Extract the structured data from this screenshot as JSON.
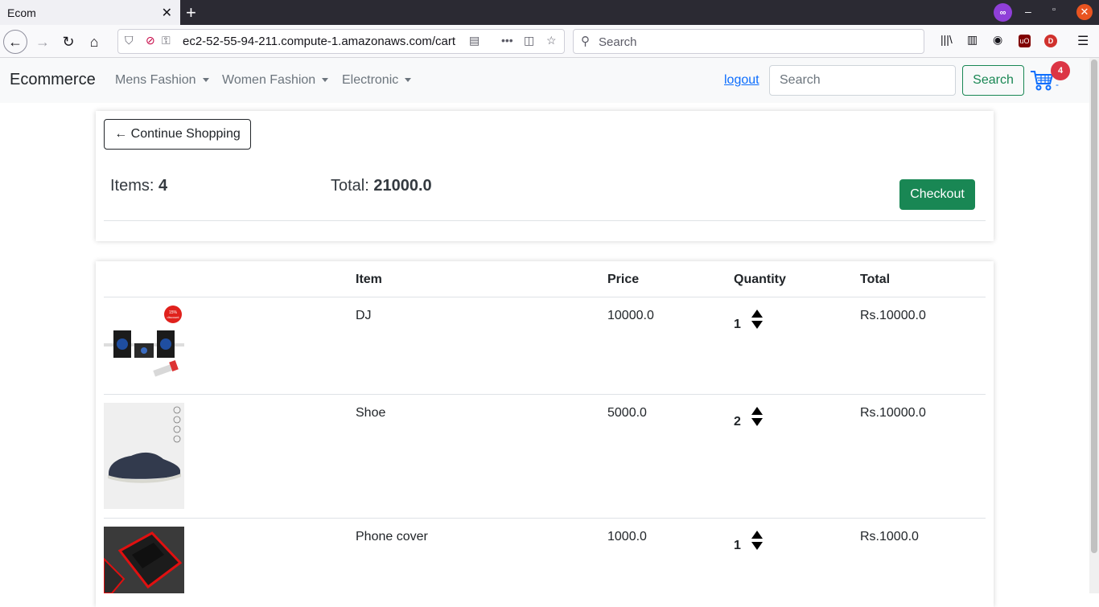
{
  "browser": {
    "tab_title": "Ecom",
    "url": "ec2-52-55-94-211.compute-1.amazonaws.com/cart",
    "search_placeholder": "Search",
    "ublock_label": "uO",
    "profile_initial": "D"
  },
  "navbar": {
    "brand": "Ecommerce",
    "menus": [
      "Mens Fashion",
      "Women Fashion",
      "Electronic"
    ],
    "logout": "logout",
    "search_placeholder": "Search",
    "search_button": "Search",
    "cart_count": "4",
    "cart_suffix": "-"
  },
  "summary": {
    "continue_label": "← Continue Shopping",
    "items_label": "Items: ",
    "items_value": "4",
    "total_label": "Total: ",
    "total_value": "21000.0",
    "checkout_label": "Checkout"
  },
  "table": {
    "headers": [
      "Item",
      "Price",
      "Quantity",
      "Total"
    ],
    "rows": [
      {
        "name": "DJ",
        "price": "10000.0",
        "quantity": "1",
        "total": "Rs.10000.0"
      },
      {
        "name": "Shoe",
        "price": "5000.0",
        "quantity": "2",
        "total": "Rs.10000.0"
      },
      {
        "name": "Phone cover",
        "price": "1000.0",
        "quantity": "1",
        "total": "Rs.1000.0"
      }
    ]
  },
  "colors": {
    "success": "#198754",
    "primary": "#0d6efd",
    "danger": "#dc3545"
  }
}
